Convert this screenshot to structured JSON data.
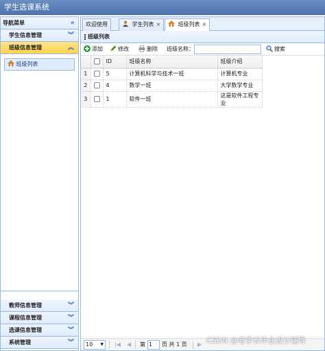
{
  "app_title": "学生选课系统",
  "sidebar": {
    "title": "导航菜单",
    "sections": [
      {
        "label": "学生信息管理"
      },
      {
        "label": "班级信息管理"
      }
    ],
    "active_link": "班级列表",
    "bottom_sections": [
      {
        "label": "教师信息管理"
      },
      {
        "label": "课程信息管理"
      },
      {
        "label": "选课信息管理"
      },
      {
        "label": "系统管理"
      }
    ]
  },
  "tabs": [
    {
      "label": "欢迎使用"
    },
    {
      "label": "学生列表"
    },
    {
      "label": "班级列表"
    }
  ],
  "panel_title": "班级列表",
  "toolbar": {
    "add": "添加",
    "edit": "修改",
    "delete": "删除",
    "search_label": "班级名称：",
    "search_value": "",
    "search_button": "搜索"
  },
  "grid": {
    "columns": [
      "ID",
      "班级名称",
      "班级介绍"
    ],
    "rows": [
      {
        "num": "1",
        "id": "5",
        "name": "计算机科学与技术一班",
        "intro": "计算机专业"
      },
      {
        "num": "2",
        "id": "4",
        "name": "数学一班",
        "intro": "大学数学专业"
      },
      {
        "num": "3",
        "id": "1",
        "name": "软件一班",
        "intro": "这是软件工程专业"
      }
    ]
  },
  "pager": {
    "page_size": "10",
    "page_prefix": "第",
    "page_value": "1",
    "page_suffix": "页 共 1 页"
  },
  "watermark": "CSDN @老学长毕业设计辅导",
  "colors": {
    "accent": "#95b8e7",
    "selected_header": "#ffd24c",
    "titlebar": "#4c72ad"
  }
}
